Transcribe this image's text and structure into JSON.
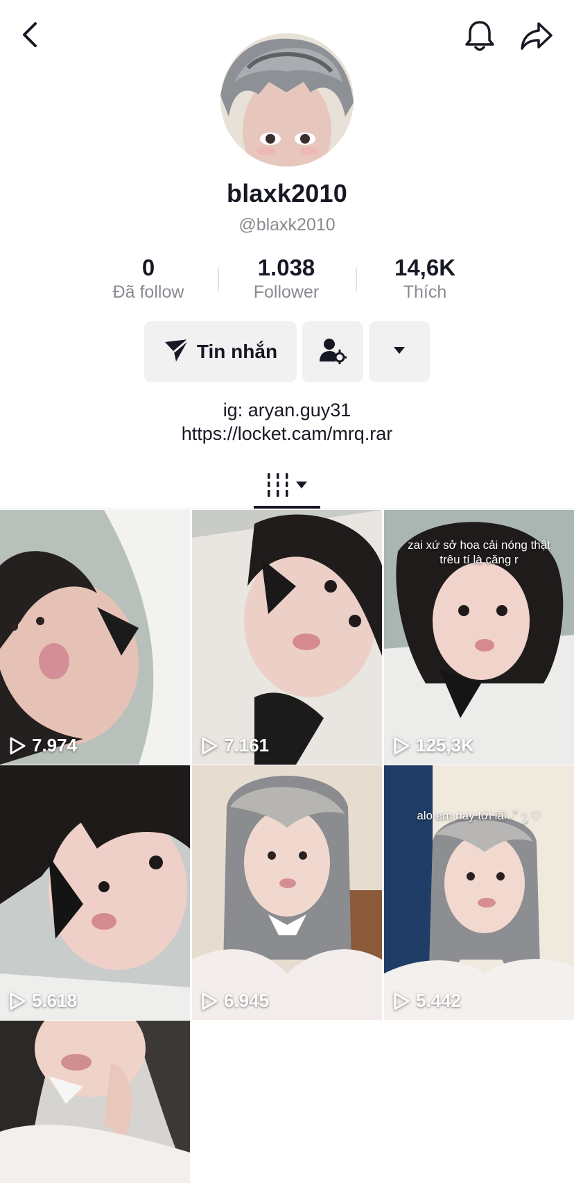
{
  "header": {
    "back_icon": "chevron-left-icon",
    "bell_icon": "bell-icon",
    "share_icon": "share-arrow-icon"
  },
  "profile": {
    "display_name": "blaxk2010",
    "handle": "@blaxk2010",
    "avatar": "profile-photo"
  },
  "stats": {
    "following": {
      "value": "0",
      "label": "Đã follow"
    },
    "followers": {
      "value": "1.038",
      "label": "Follower"
    },
    "likes": {
      "value": "14,6K",
      "label": "Thích"
    }
  },
  "actions": {
    "message_label": "Tin nhắn",
    "message_icon": "send-icon",
    "friend_icon": "user-settings-icon",
    "more_icon": "caret-down-icon"
  },
  "bio": {
    "line1": "ig: aryan.guy31",
    "line2": "https://locket.cam/mrq.rar"
  },
  "tabs": {
    "videos_icon": "grid-columns-icon",
    "dropdown_icon": "caret-down-icon"
  },
  "videos": [
    {
      "views": "7.974",
      "caption": ""
    },
    {
      "views": "7.161",
      "caption": ""
    },
    {
      "views": "125,3K",
      "caption": "zai xứ sở hoa cải nóng thật trêu tí là căng r"
    },
    {
      "views": "5.618",
      "caption": ""
    },
    {
      "views": "6.945",
      "caption": ""
    },
    {
      "views": "5.442",
      "caption": "alo em nay tới lãi ·˚ ༘ ♡"
    },
    {
      "views": "",
      "caption": ""
    }
  ],
  "colors": {
    "text": "#161823",
    "muted": "#8a8b91",
    "button_bg": "#f1f1f2"
  }
}
